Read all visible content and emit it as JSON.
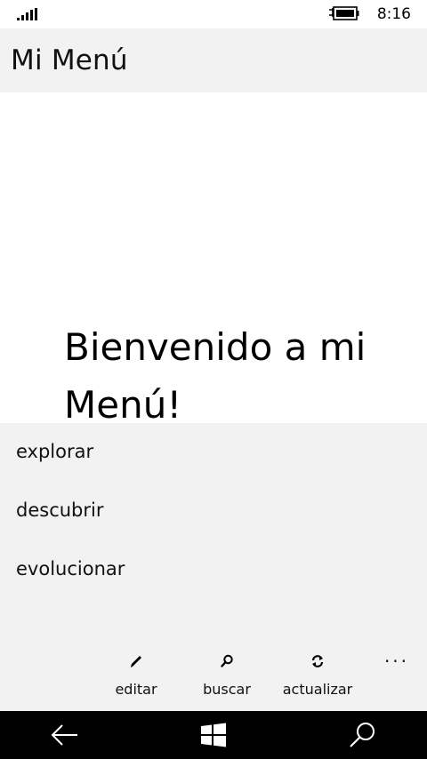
{
  "status_bar": {
    "time": "8:16",
    "icons": [
      "signal-icon",
      "battery-charging-icon"
    ]
  },
  "app": {
    "title": "Mi Menú"
  },
  "content": {
    "welcome_text": "Bienvenido a mi Menú!"
  },
  "menu": {
    "items": [
      {
        "label": "explorar"
      },
      {
        "label": "descubrir"
      },
      {
        "label": "evolucionar"
      }
    ]
  },
  "app_bar": {
    "buttons": [
      {
        "label": "editar",
        "icon": "pencil-icon"
      },
      {
        "label": "buscar",
        "icon": "search-icon"
      },
      {
        "label": "actualizar",
        "icon": "refresh-icon"
      }
    ],
    "more": "···"
  },
  "nav_bar": {
    "icons": [
      "back-arrow-icon",
      "windows-start-icon",
      "search-icon"
    ]
  },
  "colors": {
    "title_bar_bg": "#f2f2f2",
    "menu_bg": "#f2f2f2",
    "nav_bar_bg": "#000000",
    "text": "#111111"
  }
}
